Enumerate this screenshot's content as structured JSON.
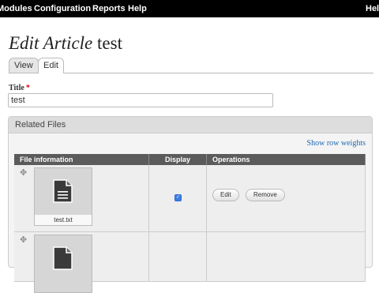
{
  "toolbar": {
    "items": [
      "Modules",
      "Configuration",
      "Reports",
      "Help"
    ],
    "greeting": "Hell"
  },
  "page": {
    "title_prefix": "Edit Article",
    "title_name": "test"
  },
  "tabs": [
    {
      "label": "View",
      "active": false
    },
    {
      "label": "Edit",
      "active": true
    }
  ],
  "title_field": {
    "label": "Title",
    "required_marker": "*",
    "value": "test"
  },
  "related_files": {
    "legend": "Related Files",
    "show_row_weights": "Show row weights",
    "columns": [
      "File information",
      "Display",
      "Operations"
    ],
    "rows": [
      {
        "filename": "test.txt",
        "display_checked": true,
        "operations": [
          "Edit",
          "Remove"
        ]
      },
      {
        "filename": "",
        "display_checked": false,
        "operations": []
      }
    ]
  },
  "icons": {
    "drag_handle": "drag-handle-icon",
    "file": "document-icon",
    "check": "checkmark-icon"
  }
}
